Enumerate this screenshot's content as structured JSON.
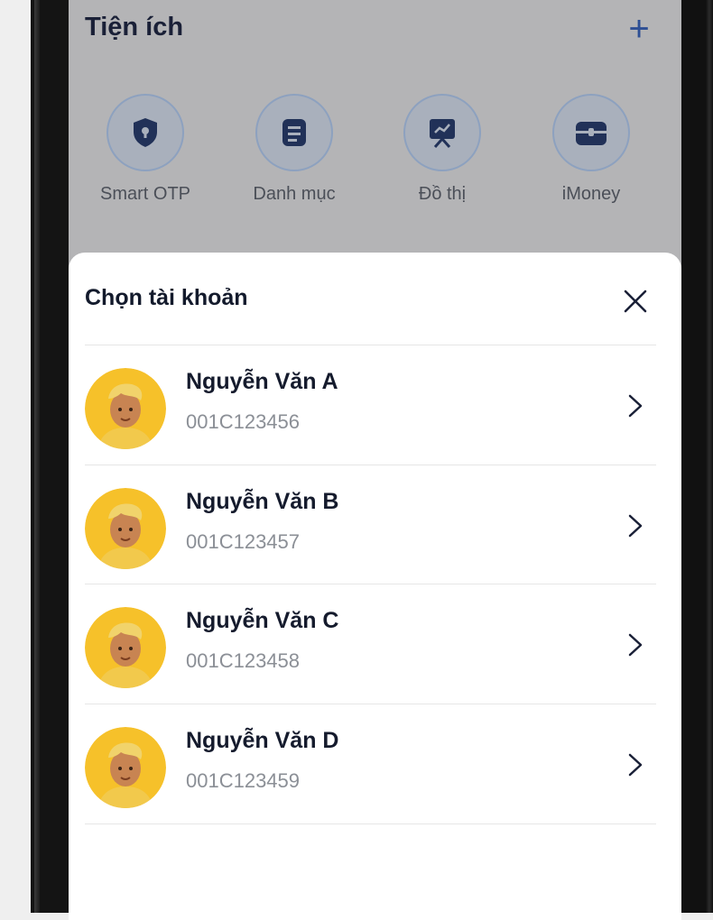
{
  "utilities": {
    "title": "Tiện ích",
    "add_icon": "plus-icon",
    "items": [
      {
        "label": "Smart OTP",
        "icon": "shield-icon"
      },
      {
        "label": "Danh mục",
        "icon": "list-icon"
      },
      {
        "label": "Đồ thị",
        "icon": "chart-board-icon"
      },
      {
        "label": "iMoney",
        "icon": "wallet-icon"
      }
    ]
  },
  "account_sheet": {
    "title": "Chọn tài khoản",
    "close_icon": "close-icon",
    "accounts": [
      {
        "name": "Nguyễn Văn A",
        "number": "001C123456"
      },
      {
        "name": "Nguyễn Văn B",
        "number": "001C123457"
      },
      {
        "name": "Nguyễn Văn C",
        "number": "001C123458"
      },
      {
        "name": "Nguyễn Văn D",
        "number": "001C123459"
      }
    ]
  },
  "colors": {
    "overlay_background": "#b4b4b6",
    "title_text": "#1a2037",
    "accent": "#2e4f94",
    "secondary_text": "#8b8f96",
    "avatar_bg": "#f6c12a"
  }
}
